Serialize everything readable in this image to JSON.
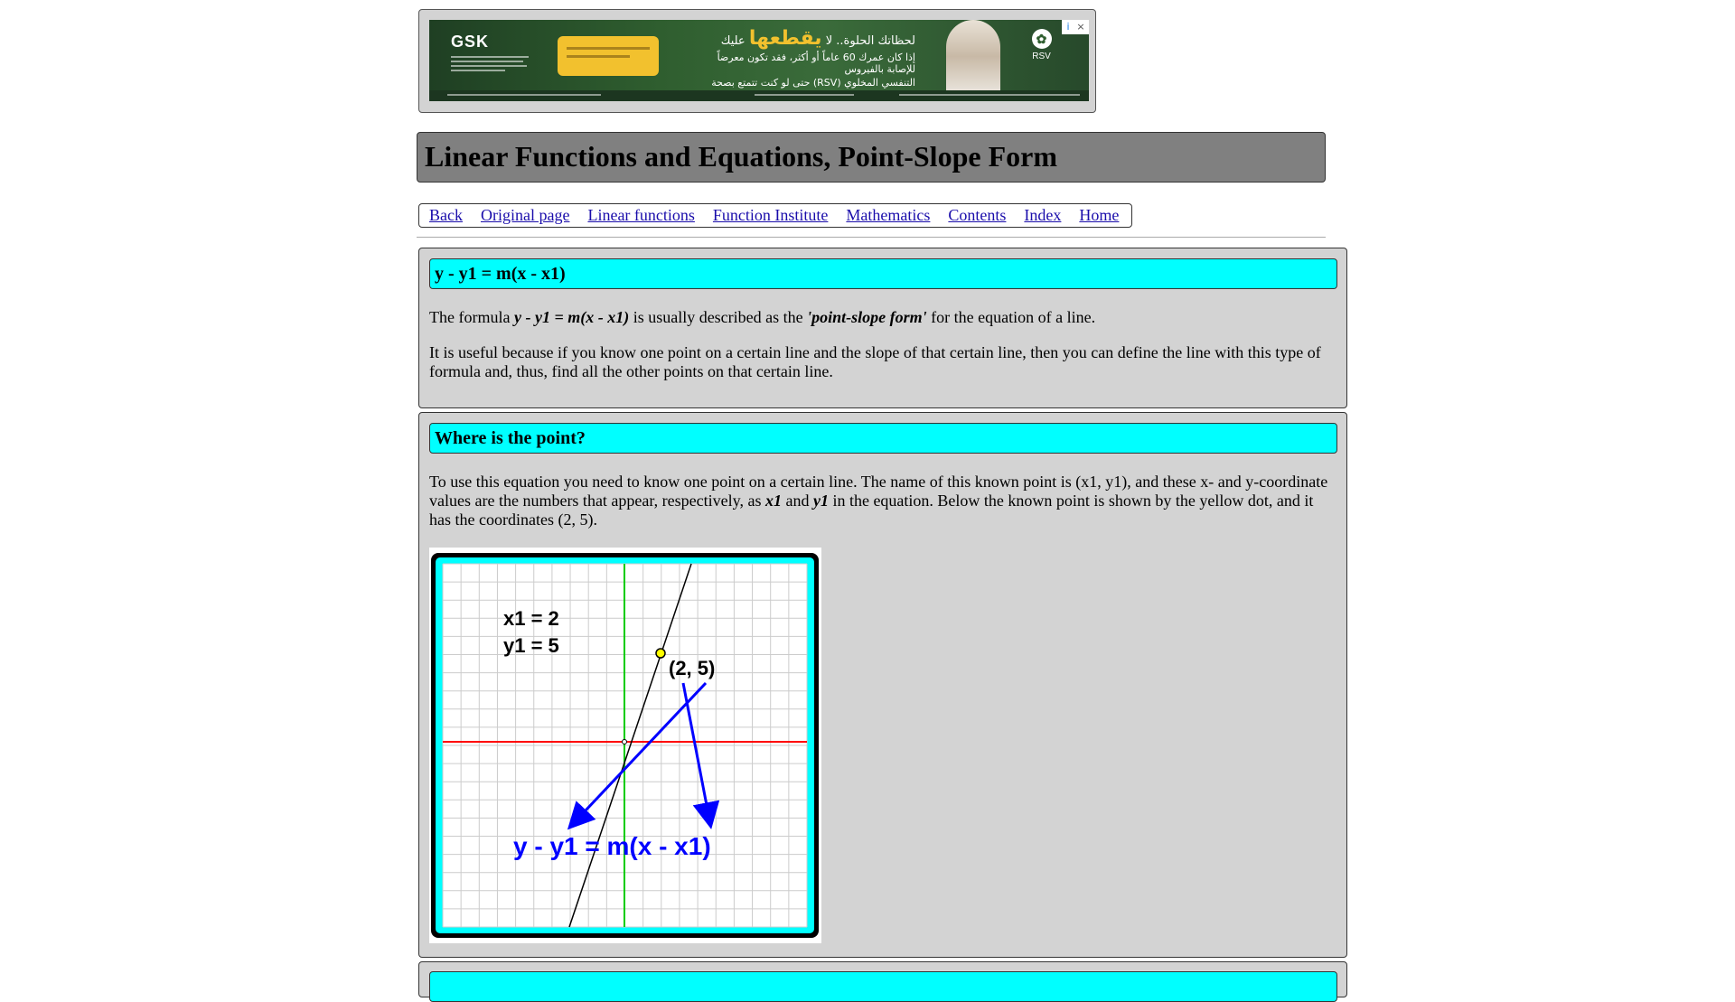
{
  "ad": {
    "brand": "GSK",
    "headline_prefix": "لحظاتك الحلوة.. لا",
    "headline_highlight": "يقطعها",
    "headline_suffix": "عليك",
    "line2": "إذا كان عمرك 60 عاماً أو أكثر، فقد تكون معرضاً للإصابة بالفيروس",
    "line3": "التنفسي المخلوي (RSV) حتى لو كنت تتمتع بصحة جيدة.",
    "badge": "RSV",
    "choices_icon": "i",
    "close_icon": "×"
  },
  "page": {
    "title": "Linear Functions and Equations, Point-Slope Form"
  },
  "nav": [
    {
      "label": "Back"
    },
    {
      "label": "Original page"
    },
    {
      "label": "Linear functions"
    },
    {
      "label": "Function Institute"
    },
    {
      "label": "Mathematics"
    },
    {
      "label": "Contents"
    },
    {
      "label": "Index"
    },
    {
      "label": "Home"
    }
  ],
  "section1": {
    "heading": "y - y1 = m(x - x1)",
    "p1": {
      "a": "The formula ",
      "formula": "y - y1 = m(x - x1)",
      "b": " is usually described as the ",
      "term": "'point-slope form'",
      "c": " for the equation of a line."
    },
    "p2": "It is useful because if you know one point on a certain line and the slope of that certain line, then you can define the line with this type of formula and, thus, find all the other points on that certain line."
  },
  "section2": {
    "heading": "Where is the point?",
    "p1": {
      "a": "To use this equation you need to know one point on a certain line. The name of this known point is (x1, y1), and these x- and y-coordinate values are the numbers that appear, respectively, as ",
      "x1": "x1",
      "and": " and ",
      "y1": "y1",
      "b": " in the equation. Below the known point is shown by the yellow dot, and it has the coordinates (2, 5)."
    },
    "figure": {
      "label_x1": "x1 = 2",
      "label_y1": "y1 = 5",
      "point_label": "(2, 5)",
      "equation": "y - y1 = m(x - x1)",
      "colors": {
        "border": "#00ffff",
        "frame": "#000000",
        "y_axis": "#00cc00",
        "x_axis": "#ff0000",
        "arrows": "#0000ff",
        "point": "#ffff00"
      }
    }
  }
}
